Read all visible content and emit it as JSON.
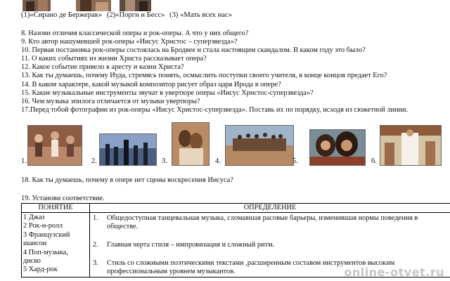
{
  "top_captions": [
    "(1)«Сирано де Бержерак»",
    "(2)«Порги и Бесс»",
    "(3) «Мать всех нас»"
  ],
  "questions": [
    "8. Назови отличия классической оперы и рок-оперы. А что у них общего?",
    "9. Кто автор нашумевшей рок-оперы «Иисус Христос – суперзвезда»?",
    "10. Первая постановка рок-оперы  состоялась на Бродвее и  стала настоящим скандалом. В каком году это было?",
    "11. О каких событиях из жизни Христа рассказывает опера?",
    "12. Какое событие привело к аресту и  казни Христа?",
    "13. Как ты думаешь, почему Иуда, стремясь понять, осмыслить поступки своего учителя, в конце концов предает Его?",
    "14. В каком характере, какой музыкой композитор рисует образ царя Ирода в опере?",
    "15. Какие музыкальные инструменты звучат в увертюре оперы «Иисус Христос-суперзвезда»?",
    "16. Чем музыка эпилога отличается от музыки увертюры?",
    "17.Перед тобой фотографии из рок-оперы «Иисус Христос-суперзвезда». Поставь их по порядку, исходя из сюжетной линии."
  ],
  "photo_numbers": [
    "1.",
    "2.",
    "3.",
    "4.",
    "5.",
    "6."
  ],
  "q18": "18. Как ты думаешь, почему в опере нет сцены воскресения Иисуса?",
  "q19": "19. Установи соответствие.",
  "table": {
    "header_concept": "ПОНЯТИЕ",
    "header_definition": "ОПРЕДЕЛЕНИЕ",
    "concepts": [
      "1  Джаз",
      "2  Рок-н-ролл",
      "3  Французский",
      "шансон",
      "4  Поп-музыка,",
      "диско",
      "5  Хард-рок"
    ],
    "definitions": [
      {
        "num": "1.",
        "text": "Общедоступная танцевальная музыка, сломавшая расовые барьеры, изменившая нормы поведения в обществе."
      },
      {
        "num": "2.",
        "text": "Главная черта стиля – импровизация и сложный ритм."
      },
      {
        "num": "3.",
        "text": "Стиль со сложными поэтическими текстами ,расширенным составом инструментов высоким профессиональным уровнем музыкантов."
      }
    ]
  },
  "watermark": "online-otvet.ru"
}
